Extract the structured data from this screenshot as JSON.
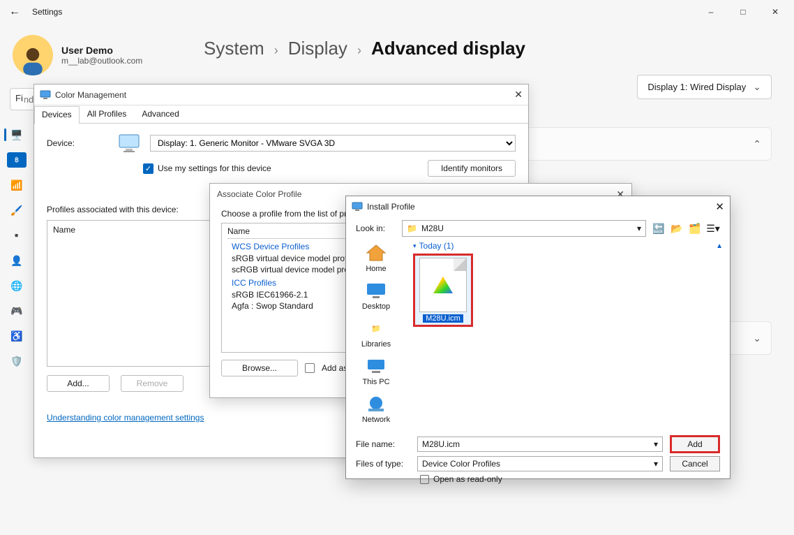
{
  "settings": {
    "title": "Settings",
    "user": {
      "name": "User Demo",
      "email": "m__lab@outlook.com"
    },
    "search_placeholder": "Find a setting",
    "search_partial": "Fi",
    "breadcrumb": {
      "a": "System",
      "b": "Display",
      "c": "Advanced display"
    },
    "display_selector": "Display 1: Wired Display"
  },
  "cm": {
    "title": "Color Management",
    "tabs": {
      "devices": "Devices",
      "all": "All Profiles",
      "adv": "Advanced"
    },
    "device_label": "Device:",
    "device_value": "Display: 1. Generic Monitor - VMware SVGA 3D",
    "use_settings": "Use my settings for this device",
    "identify": "Identify monitors",
    "profiles_label": "Profiles associated with this device:",
    "col_name": "Name",
    "add": "Add...",
    "remove": "Remove",
    "link": "Understanding color management settings"
  },
  "assoc": {
    "title": "Associate Color Profile",
    "prompt": "Choose a profile from the list of profiles installed on the system.",
    "col_name": "Name",
    "group1": "WCS Device Profiles",
    "item1": "sRGB virtual device model profile",
    "item2": "scRGB virtual device model profile",
    "group2": "ICC Profiles",
    "item3": "sRGB IEC61966-2.1",
    "item4": "Agfa : Swop Standard",
    "browse": "Browse...",
    "add_adv": "Add as Advanced Color"
  },
  "inst": {
    "title": "Install Profile",
    "lookin": "Look in:",
    "folder": "M28U",
    "places": {
      "home": "Home",
      "desktop": "Desktop",
      "libraries": "Libraries",
      "thispc": "This PC",
      "network": "Network"
    },
    "group": "Today (1)",
    "file": "M28U.icm",
    "filename_label": "File name:",
    "filename_value": "M28U.icm",
    "filetype_label": "Files of type:",
    "filetype_value": "Device Color Profiles",
    "readonly": "Open as read-only",
    "add": "Add",
    "cancel": "Cancel"
  }
}
